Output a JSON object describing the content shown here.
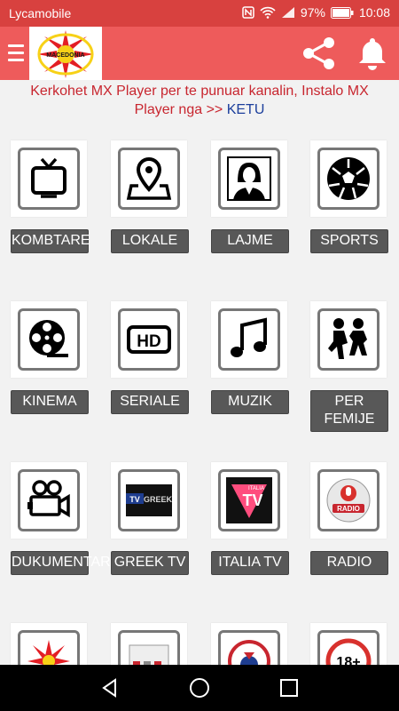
{
  "status": {
    "carrier": "Lycamobile",
    "battery": "97%",
    "time": "10:08"
  },
  "appbar": {
    "logo_text": "MACEDONIA"
  },
  "notice": {
    "text": "Kerkohet MX Player per te punuar kanalin, Instalo MX Player nga >> ",
    "link": "KETU"
  },
  "categories": [
    {
      "label": "KOMBTARE",
      "icon": "tv-icon"
    },
    {
      "label": "LOKALE",
      "icon": "location-pin-icon"
    },
    {
      "label": "LAJME",
      "icon": "news-anchor-icon"
    },
    {
      "label": "SPORTS",
      "icon": "soccer-ball-icon"
    },
    {
      "label": "KINEMA",
      "icon": "film-reel-icon"
    },
    {
      "label": "SERIALE",
      "icon": "hd-icon"
    },
    {
      "label": "MUZIK",
      "icon": "music-note-icon"
    },
    {
      "label": "PER FEMIJE",
      "icon": "kids-icon"
    },
    {
      "label": "DUKUMENTARE",
      "icon": "video-camera-icon"
    },
    {
      "label": "GREEK TV",
      "icon": "greek-tv-icon"
    },
    {
      "label": "ITALIA TV",
      "icon": "italia-tv-icon"
    },
    {
      "label": "RADIO",
      "icon": "radio-icon"
    }
  ],
  "greek_tv_logo": {
    "tv": "TV",
    "word": "GREEK"
  },
  "italia_tv_logo": {
    "top": "ITALIA",
    "tv": "TV"
  },
  "radio_logo": {
    "word": "RADIO"
  },
  "hd_logo": {
    "word": "HD"
  },
  "bottom_row_icons": [
    "macedonia-flag-icon",
    "tv-channel-icon",
    "emblem-icon",
    "adult-18-icon"
  ],
  "adult_badge": "18+",
  "navbar": {
    "icons": [
      "back-icon",
      "home-icon",
      "recents-icon"
    ]
  }
}
